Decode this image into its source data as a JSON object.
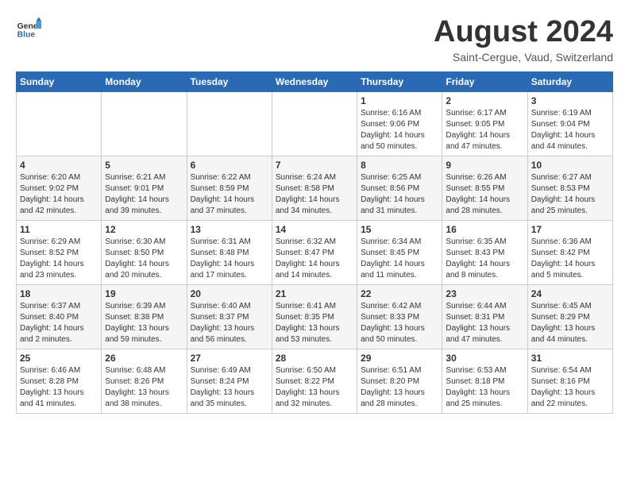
{
  "header": {
    "logo_general": "General",
    "logo_blue": "Blue",
    "month_title": "August 2024",
    "location": "Saint-Cergue, Vaud, Switzerland"
  },
  "weekdays": [
    "Sunday",
    "Monday",
    "Tuesday",
    "Wednesday",
    "Thursday",
    "Friday",
    "Saturday"
  ],
  "weeks": [
    [
      {
        "day": "",
        "info": ""
      },
      {
        "day": "",
        "info": ""
      },
      {
        "day": "",
        "info": ""
      },
      {
        "day": "",
        "info": ""
      },
      {
        "day": "1",
        "info": "Sunrise: 6:16 AM\nSunset: 9:06 PM\nDaylight: 14 hours\nand 50 minutes."
      },
      {
        "day": "2",
        "info": "Sunrise: 6:17 AM\nSunset: 9:05 PM\nDaylight: 14 hours\nand 47 minutes."
      },
      {
        "day": "3",
        "info": "Sunrise: 6:19 AM\nSunset: 9:04 PM\nDaylight: 14 hours\nand 44 minutes."
      }
    ],
    [
      {
        "day": "4",
        "info": "Sunrise: 6:20 AM\nSunset: 9:02 PM\nDaylight: 14 hours\nand 42 minutes."
      },
      {
        "day": "5",
        "info": "Sunrise: 6:21 AM\nSunset: 9:01 PM\nDaylight: 14 hours\nand 39 minutes."
      },
      {
        "day": "6",
        "info": "Sunrise: 6:22 AM\nSunset: 8:59 PM\nDaylight: 14 hours\nand 37 minutes."
      },
      {
        "day": "7",
        "info": "Sunrise: 6:24 AM\nSunset: 8:58 PM\nDaylight: 14 hours\nand 34 minutes."
      },
      {
        "day": "8",
        "info": "Sunrise: 6:25 AM\nSunset: 8:56 PM\nDaylight: 14 hours\nand 31 minutes."
      },
      {
        "day": "9",
        "info": "Sunrise: 6:26 AM\nSunset: 8:55 PM\nDaylight: 14 hours\nand 28 minutes."
      },
      {
        "day": "10",
        "info": "Sunrise: 6:27 AM\nSunset: 8:53 PM\nDaylight: 14 hours\nand 25 minutes."
      }
    ],
    [
      {
        "day": "11",
        "info": "Sunrise: 6:29 AM\nSunset: 8:52 PM\nDaylight: 14 hours\nand 23 minutes."
      },
      {
        "day": "12",
        "info": "Sunrise: 6:30 AM\nSunset: 8:50 PM\nDaylight: 14 hours\nand 20 minutes."
      },
      {
        "day": "13",
        "info": "Sunrise: 6:31 AM\nSunset: 8:48 PM\nDaylight: 14 hours\nand 17 minutes."
      },
      {
        "day": "14",
        "info": "Sunrise: 6:32 AM\nSunset: 8:47 PM\nDaylight: 14 hours\nand 14 minutes."
      },
      {
        "day": "15",
        "info": "Sunrise: 6:34 AM\nSunset: 8:45 PM\nDaylight: 14 hours\nand 11 minutes."
      },
      {
        "day": "16",
        "info": "Sunrise: 6:35 AM\nSunset: 8:43 PM\nDaylight: 14 hours\nand 8 minutes."
      },
      {
        "day": "17",
        "info": "Sunrise: 6:36 AM\nSunset: 8:42 PM\nDaylight: 14 hours\nand 5 minutes."
      }
    ],
    [
      {
        "day": "18",
        "info": "Sunrise: 6:37 AM\nSunset: 8:40 PM\nDaylight: 14 hours\nand 2 minutes."
      },
      {
        "day": "19",
        "info": "Sunrise: 6:39 AM\nSunset: 8:38 PM\nDaylight: 13 hours\nand 59 minutes."
      },
      {
        "day": "20",
        "info": "Sunrise: 6:40 AM\nSunset: 8:37 PM\nDaylight: 13 hours\nand 56 minutes."
      },
      {
        "day": "21",
        "info": "Sunrise: 6:41 AM\nSunset: 8:35 PM\nDaylight: 13 hours\nand 53 minutes."
      },
      {
        "day": "22",
        "info": "Sunrise: 6:42 AM\nSunset: 8:33 PM\nDaylight: 13 hours\nand 50 minutes."
      },
      {
        "day": "23",
        "info": "Sunrise: 6:44 AM\nSunset: 8:31 PM\nDaylight: 13 hours\nand 47 minutes."
      },
      {
        "day": "24",
        "info": "Sunrise: 6:45 AM\nSunset: 8:29 PM\nDaylight: 13 hours\nand 44 minutes."
      }
    ],
    [
      {
        "day": "25",
        "info": "Sunrise: 6:46 AM\nSunset: 8:28 PM\nDaylight: 13 hours\nand 41 minutes."
      },
      {
        "day": "26",
        "info": "Sunrise: 6:48 AM\nSunset: 8:26 PM\nDaylight: 13 hours\nand 38 minutes."
      },
      {
        "day": "27",
        "info": "Sunrise: 6:49 AM\nSunset: 8:24 PM\nDaylight: 13 hours\nand 35 minutes."
      },
      {
        "day": "28",
        "info": "Sunrise: 6:50 AM\nSunset: 8:22 PM\nDaylight: 13 hours\nand 32 minutes."
      },
      {
        "day": "29",
        "info": "Sunrise: 6:51 AM\nSunset: 8:20 PM\nDaylight: 13 hours\nand 28 minutes."
      },
      {
        "day": "30",
        "info": "Sunrise: 6:53 AM\nSunset: 8:18 PM\nDaylight: 13 hours\nand 25 minutes."
      },
      {
        "day": "31",
        "info": "Sunrise: 6:54 AM\nSunset: 8:16 PM\nDaylight: 13 hours\nand 22 minutes."
      }
    ]
  ]
}
